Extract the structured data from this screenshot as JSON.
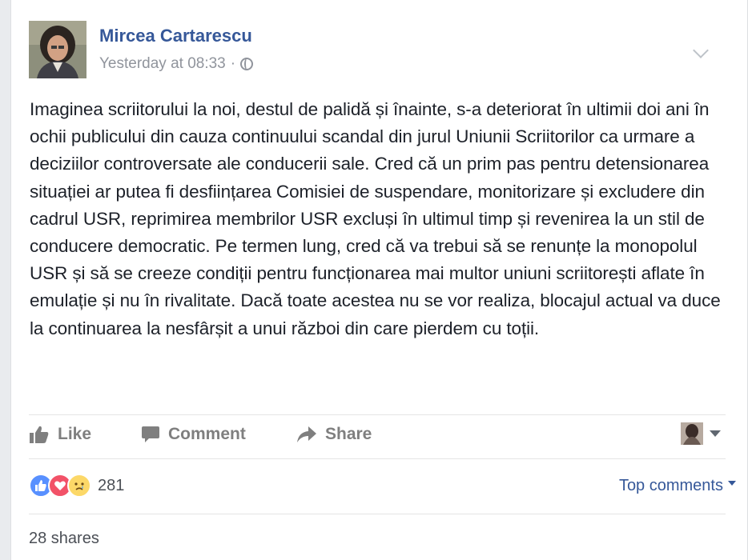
{
  "post": {
    "author": "Mircea Cartarescu",
    "timestamp": "Yesterday at 08:33",
    "meta_separator": "·",
    "privacy_icon": "globe-icon",
    "body": "Imaginea scriitorului la noi, destul de palidă și înainte, s-a deteriorat în ultimii doi ani în ochii publicului din cauza continuului scandal din jurul Uniunii Scriitorilor ca urmare a deciziilor controversate ale conducerii sale. Cred că un prim pas pentru detensionarea situației ar putea fi desființarea Comisiei de suspendare, monitorizare și excludere din cadrul USR, reprimirea membrilor USR excluși în ultimul timp și revenirea la un stil de conducere democratic. Pe termen lung, cred că va trebui să se renunțe la monopolul USR și să se creeze condiții pentru funcționarea mai multor uniuni scriitorești aflate în emulație și nu în rivalitate. Dacă toate acestea nu se vor realiza, blocajul actual va duce la continuarea la nesfârșit a unui război din care pierdem cu toții."
  },
  "actions": {
    "like": "Like",
    "comment": "Comment",
    "share": "Share"
  },
  "reactions": {
    "types": [
      "like",
      "love",
      "sad"
    ],
    "count": "281"
  },
  "comments": {
    "sort_label": "Top comments"
  },
  "shares": {
    "label": "28 shares"
  },
  "colors": {
    "link": "#365899",
    "text": "#1d2129",
    "muted": "#90949c",
    "action": "#7f7f7f",
    "like": "#5890ff",
    "love": "#f25268",
    "sad": "#fcd868"
  }
}
